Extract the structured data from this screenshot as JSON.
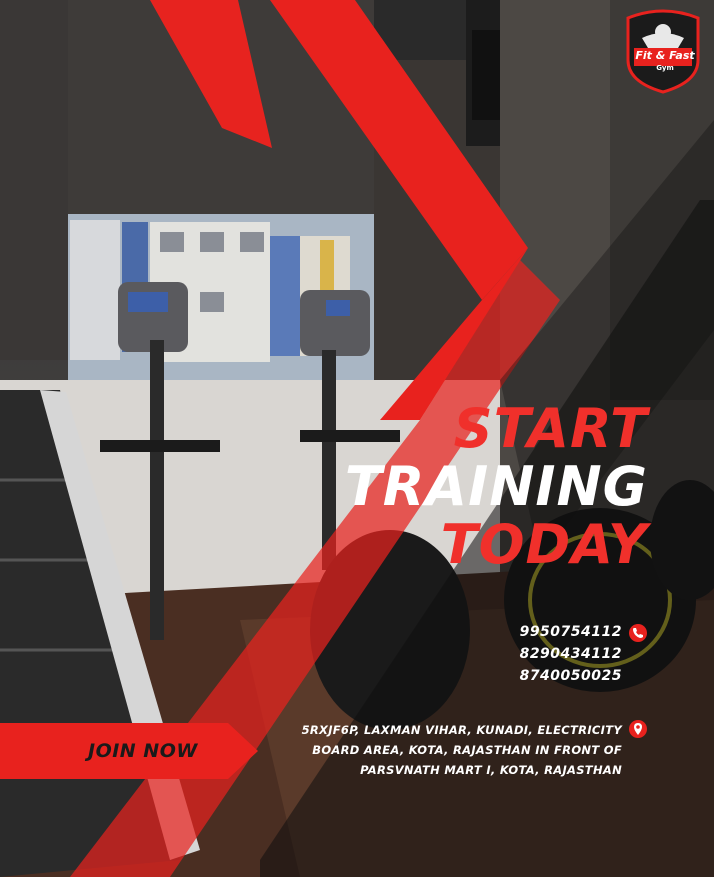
{
  "brand": {
    "logo_line1": "Fit & Fast",
    "logo_line2": "Gym"
  },
  "headline": {
    "line1": "START",
    "line2": "TRAINING",
    "line3": "TODAY"
  },
  "contact": {
    "phones": [
      "9950754112",
      "8290434112",
      "8740050025"
    ],
    "address_lines": [
      "5RXJF6P, LAXMAN VIHAR, KUNADI, ELECTRICITY",
      "BOARD AREA, KOTA, RAJASTHAN IN FRONT OF",
      "PARSVNATH MART I, KOTA, RAJASTHAN"
    ]
  },
  "cta": {
    "label": "JOIN NOW"
  },
  "colors": {
    "accent_red": "#f0302b",
    "text_white": "#ffffff",
    "dark": "#1a1a1a"
  }
}
